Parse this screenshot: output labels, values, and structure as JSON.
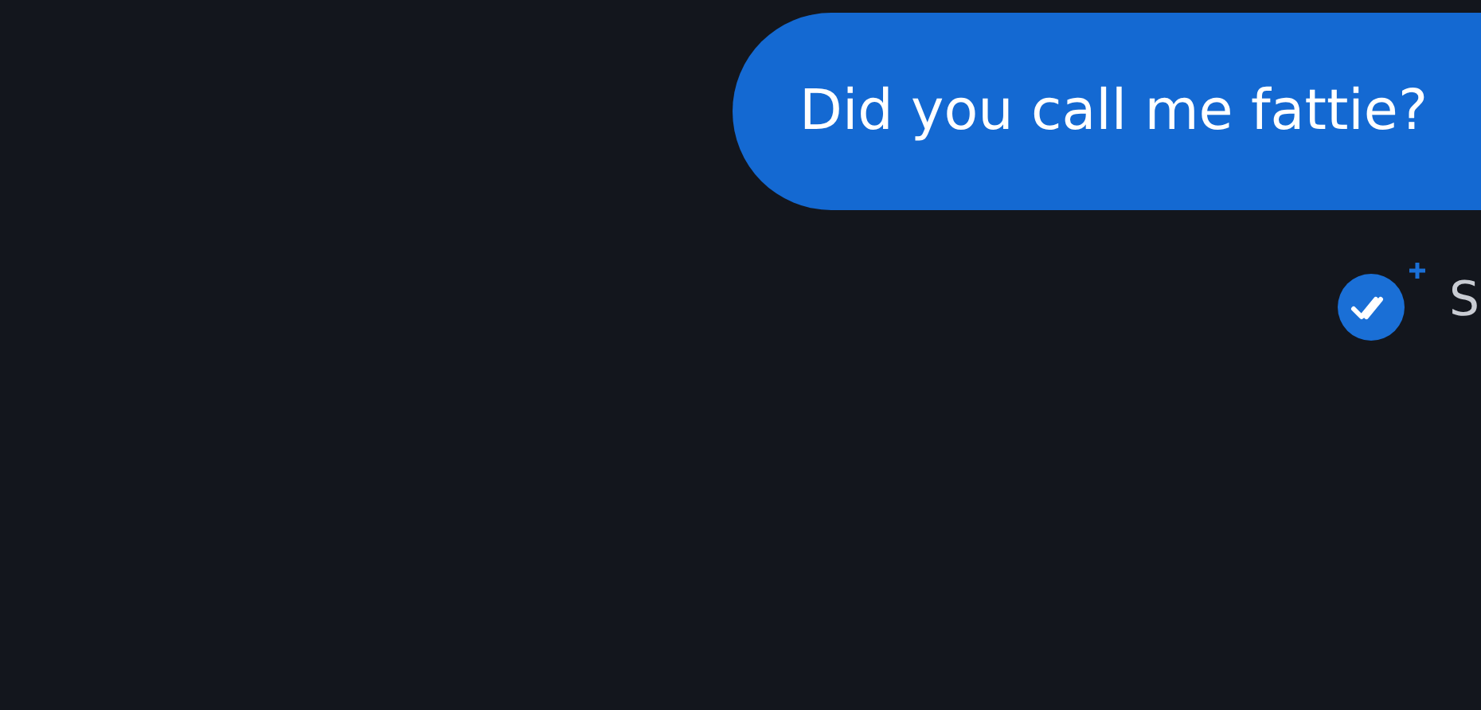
{
  "messages": [
    {
      "text": "Did you call me fattie?",
      "status": "S"
    }
  ]
}
